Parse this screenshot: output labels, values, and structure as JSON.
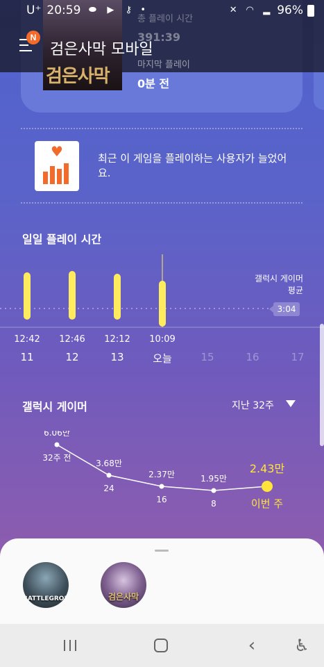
{
  "status_bar": {
    "carrier": "U⁺",
    "time": "20:59",
    "battery": "96%"
  },
  "app_bar": {
    "title": "검은사막 모바일",
    "badge": "N"
  },
  "game_card": {
    "poster_title": "검은사막",
    "total_play_label": "총 플레이 시간",
    "total_play_value": "391:39",
    "last_play_label": "마지막 플레이",
    "last_play_value": "0분 전"
  },
  "notice": {
    "text": "최근 이 게임을 플레이하는 사용자가 늘었어요."
  },
  "daily": {
    "title": "일일 플레이 시간",
    "avg_label_line1": "갤럭시 게이머",
    "avg_label_line2": "평균",
    "avg_value": "3:04",
    "days": [
      {
        "time": "12:42",
        "day": "11",
        "active": true
      },
      {
        "time": "12:46",
        "day": "12",
        "active": true
      },
      {
        "time": "12:12",
        "day": "13",
        "active": true
      },
      {
        "time": "10:09",
        "day": "오늘",
        "active": true
      },
      {
        "time": "",
        "day": "15",
        "active": false
      },
      {
        "time": "",
        "day": "16",
        "active": false
      },
      {
        "time": "",
        "day": "17",
        "active": false
      }
    ]
  },
  "weekly": {
    "title": "갤럭시 게이머",
    "range": "지난 32주",
    "points": [
      {
        "value": "6.06만",
        "label": "32주 전",
        "current": false
      },
      {
        "value": "3.68만",
        "label": "24",
        "current": false
      },
      {
        "value": "2.37만",
        "label": "16",
        "current": false
      },
      {
        "value": "1.95만",
        "label": "8",
        "current": false
      },
      {
        "value": "2.43만",
        "label": "이번 주",
        "current": true
      }
    ],
    "highlight_color": "#ffe53b"
  },
  "bottom_sheet": {
    "games": [
      {
        "name": "BATTLEGROUNDS",
        "icon": "pubg-mobile-icon"
      },
      {
        "name": "검은사막",
        "icon": "black-desert-icon"
      }
    ]
  },
  "colors": {
    "accent": "#ffeb5e",
    "badge": "#f26b2b"
  }
}
